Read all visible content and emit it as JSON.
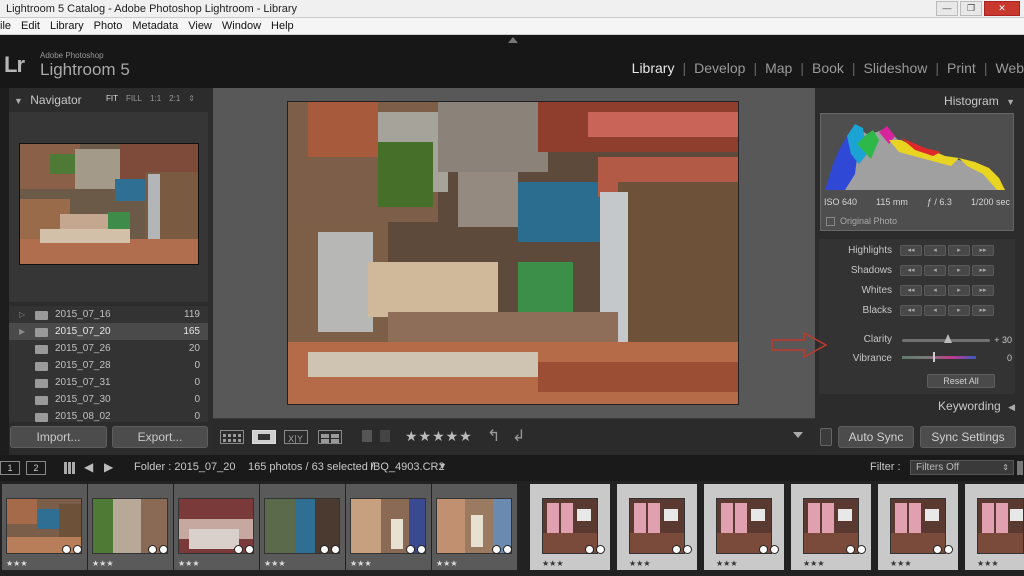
{
  "window": {
    "title": "Lightroom 5 Catalog - Adobe Photoshop Lightroom - Library",
    "controls": [
      "—",
      "❐",
      "✕"
    ]
  },
  "menu": [
    "ile",
    "Edit",
    "Library",
    "Photo",
    "Metadata",
    "View",
    "Window",
    "Help"
  ],
  "brand": {
    "mark": "Lr",
    "sub": "Adobe Photoshop",
    "name": "Lightroom 5"
  },
  "modules": [
    {
      "label": "Library",
      "active": true
    },
    {
      "label": "Develop"
    },
    {
      "label": "Map"
    },
    {
      "label": "Book"
    },
    {
      "label": "Slideshow"
    },
    {
      "label": "Print"
    },
    {
      "label": "Web"
    }
  ],
  "navigator": {
    "title": "Navigator",
    "zoom_options": [
      "FIT",
      "FILL",
      "1:1",
      "2:1"
    ]
  },
  "folders": [
    {
      "name": "2015_07_16",
      "count": "119",
      "selected": false
    },
    {
      "name": "2015_07_20",
      "count": "165",
      "selected": true
    },
    {
      "name": "2015_07_26",
      "count": "20",
      "selected": false
    },
    {
      "name": "2015_07_28",
      "count": "0",
      "selected": false
    },
    {
      "name": "2015_07_31",
      "count": "0",
      "selected": false
    },
    {
      "name": "2015_07_30",
      "count": "0",
      "selected": false
    },
    {
      "name": "2015_08_02",
      "count": "0",
      "selected": false
    }
  ],
  "left_buttons": {
    "import": "Import...",
    "export": "Export..."
  },
  "toolbar": {
    "stars": "★★★★★"
  },
  "histogram": {
    "title": "Histogram",
    "iso": "ISO 640",
    "focal": "115 mm",
    "aperture": "ƒ / 6.3",
    "shutter": "1/200 sec",
    "original_photo": "Original Photo"
  },
  "quick_develop": {
    "tone": [
      {
        "label": "Highlights"
      },
      {
        "label": "Shadows"
      },
      {
        "label": "Whites"
      },
      {
        "label": "Blacks"
      }
    ],
    "btn_glyphs": [
      "◂◂",
      "◂",
      "▸",
      "▸▸"
    ],
    "clarity": {
      "label": "Clarity",
      "value": "+ 30"
    },
    "vibrance": {
      "label": "Vibrance",
      "value": "0"
    },
    "reset": "Reset All"
  },
  "keywording": {
    "title": "Keywording"
  },
  "sync": {
    "auto": "Auto Sync",
    "settings": "Sync Settings"
  },
  "filmstrip_bar": {
    "screen1": "1",
    "screen2": "2",
    "folder": "Folder : 2015_07_20",
    "info": "165 photos / 63 selected /",
    "file": "IBQ_4903.CR2",
    "filter_label": "Filter :",
    "filter_value": "Filters Off"
  },
  "filmstrip": [
    {
      "stars": "★★★",
      "selected": false
    },
    {
      "stars": "★★★",
      "selected": false
    },
    {
      "stars": "★★★",
      "selected": false
    },
    {
      "stars": "★★★",
      "selected": false
    },
    {
      "stars": "★★★",
      "selected": false
    },
    {
      "stars": "★★★",
      "selected": false
    },
    {
      "stars": "★★★",
      "selected": true
    },
    {
      "stars": "★★★",
      "selected": true
    },
    {
      "stars": "★★★",
      "selected": true
    },
    {
      "stars": "★★★",
      "selected": true
    },
    {
      "stars": "★★★",
      "selected": true
    },
    {
      "stars": "★★★",
      "selected": true
    }
  ],
  "colors": {
    "accent": "#e6e6e6",
    "arrow": "#c0392b"
  }
}
